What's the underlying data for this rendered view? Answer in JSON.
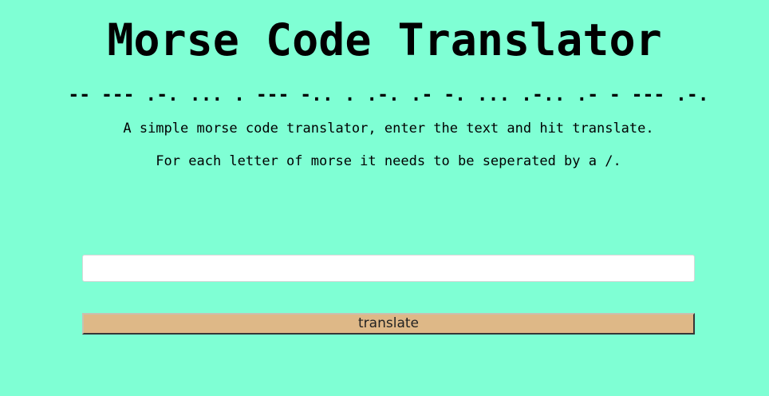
{
  "header": {
    "title": "Morse Code Translator",
    "morse_title": "-- --- .-. ... . --- -.. . .-. .- -. ... .-.. .- - --- .-."
  },
  "main": {
    "description": "A simple morse code translator, enter the text and hit translate.",
    "instruction": "For each letter of morse it needs to be seperated by a /.",
    "input": {
      "value": "",
      "placeholder": ""
    },
    "translate_label": "translate"
  },
  "colors": {
    "background": "#7fffd4",
    "button": "#deb887",
    "input": "#ffffff"
  }
}
